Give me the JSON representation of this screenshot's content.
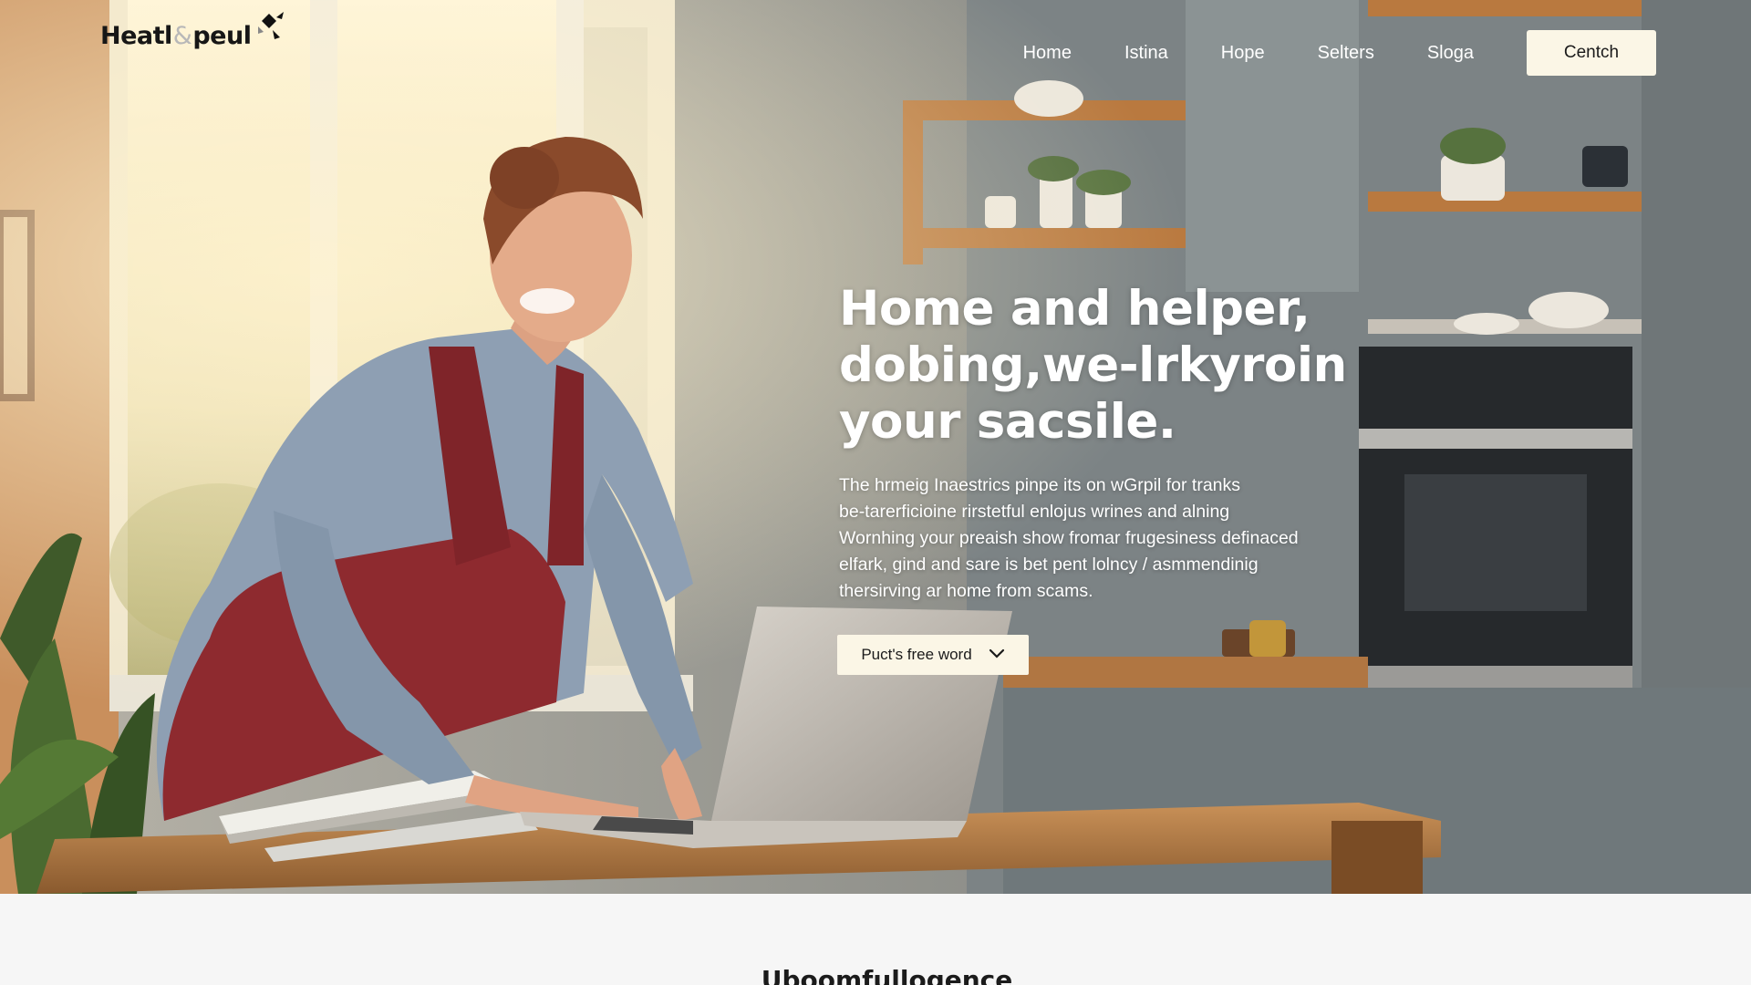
{
  "brand": {
    "name_part1": "Heatl",
    "ampersand": "&",
    "name_part2": "peul",
    "logo_icon": "diamond-mark-icon"
  },
  "nav": {
    "links": [
      "Home",
      "Istina",
      "Hope",
      "Selters",
      "Sloga"
    ],
    "cta_label": "Centch"
  },
  "hero": {
    "title": "Home and helper,\ndobing,we-lrkyroin\nyour sacsile.",
    "description": "The hrmeig Inaestrics pinpe its on wGrpil for tranks\nbe-tarerficioine rirstetful enlojus wrines and alning\nWornhing your preaish show fromar frugesiness definaced\nelfark, gind and sare is bet pent lolncy / asmmendinig\nthersirving ar home from scams.",
    "button_label": "Puct's free word",
    "button_icon": "chevron-down-icon"
  },
  "section": {
    "title": "Uboomfullogence"
  },
  "colors": {
    "accent_cream": "#fbf6e6",
    "apron_red": "#8e2a2f",
    "text_dark": "#1b1b1b"
  }
}
